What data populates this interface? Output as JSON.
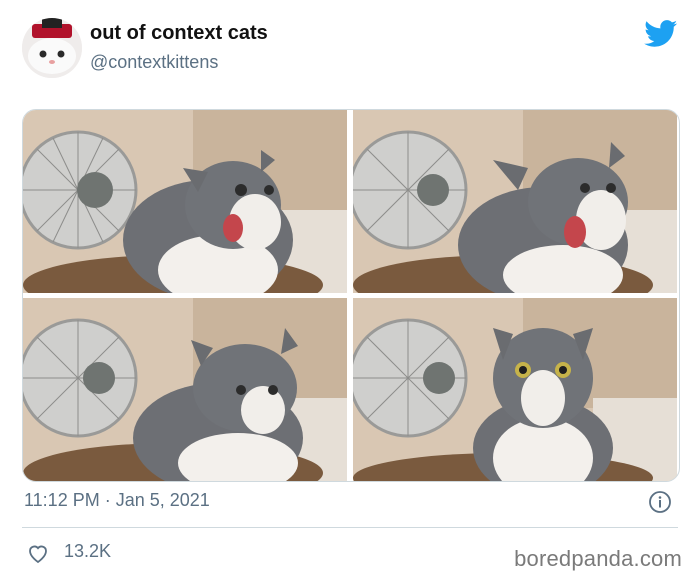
{
  "tweet": {
    "author_name": "out of context cats",
    "author_handle": "@contextkittens",
    "timestamp": "11:12 PM · Jan 5, 2021",
    "likes": "13.2K"
  },
  "media": {
    "photos": [
      {
        "subject": "gray and white cat with mouth wide open next to fan"
      },
      {
        "subject": "gray and white cat with mouth wide open next to fan"
      },
      {
        "subject": "gray and white cat turning toward viewer"
      },
      {
        "subject": "gray and white cat staring wide-eyed"
      }
    ]
  },
  "icons": {
    "brand": "twitter-bird-icon",
    "info": "info-icon",
    "like": "heart-icon"
  },
  "colors": {
    "twitter_blue": "#1da1f2",
    "secondary_text": "#5b7083",
    "border": "#cfd9de"
  },
  "watermark": "boredpanda.com"
}
